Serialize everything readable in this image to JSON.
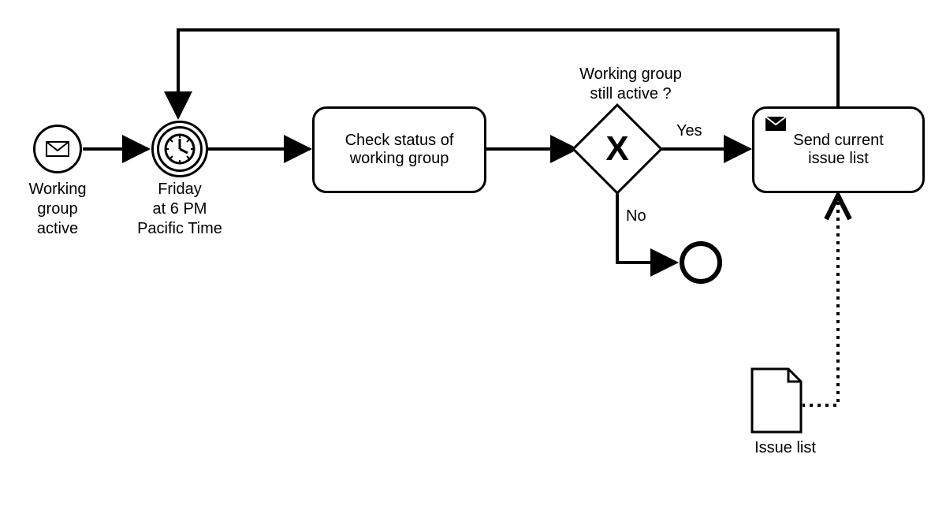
{
  "events": {
    "start": {
      "label": "Working\ngroup\nactive"
    },
    "timer": {
      "label": "Friday\nat 6 PM\nPacific Time"
    }
  },
  "tasks": {
    "check": {
      "label": "Check status of\nworking group"
    },
    "send": {
      "label": "Send current\nissue list"
    }
  },
  "gateway": {
    "question": "Working group\nstill active ?",
    "yes": "Yes",
    "no": "No"
  },
  "data": {
    "issue_list": "Issue list"
  }
}
